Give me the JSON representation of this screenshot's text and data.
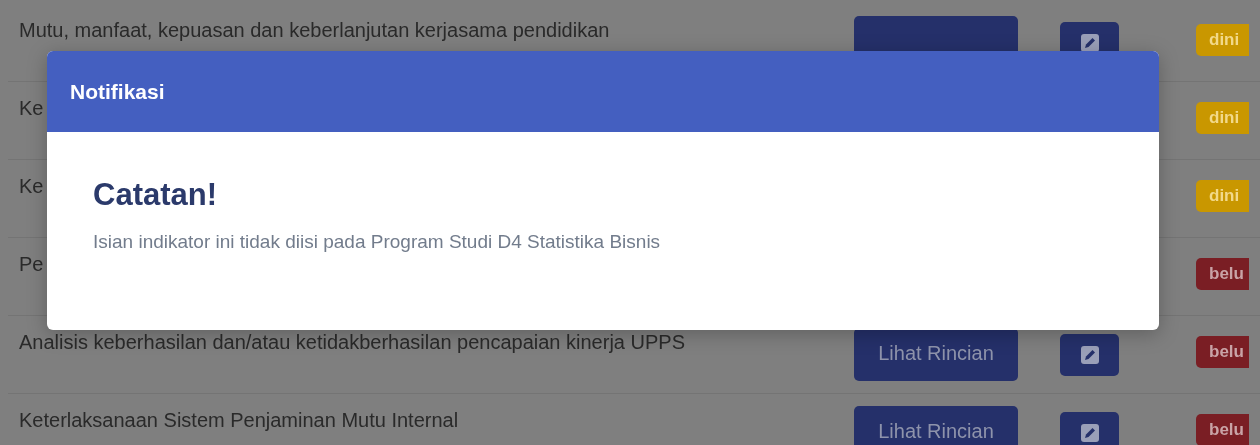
{
  "rows": [
    {
      "title": "Mutu, manfaat, kepuasan dan keberlanjutan kerjasama pendidikan",
      "detail_button": true,
      "edit": true,
      "status": {
        "label": "dini",
        "kind": "filled"
      }
    },
    {
      "title": "Ke",
      "status": {
        "label": "dini",
        "kind": "filled"
      }
    },
    {
      "title": "Ke",
      "status": {
        "label": "dini",
        "kind": "filled"
      }
    },
    {
      "title": "Pe",
      "status": {
        "label": "belu",
        "kind": "empty"
      }
    },
    {
      "title": "Analisis keberhasilan dan/atau ketidakberhasilan pencapaian kinerja UPPS",
      "detail_button": true,
      "detail_label": "Lihat Rincian",
      "edit": true,
      "status": {
        "label": "belu",
        "kind": "empty"
      }
    },
    {
      "title": "Keterlaksanaan Sistem Penjaminan Mutu Internal",
      "detail_button": true,
      "detail_label": "Lihat Rincian",
      "edit": true,
      "status": {
        "label": "belu",
        "kind": "empty"
      }
    }
  ],
  "modal": {
    "title": "Notifikasi",
    "heading": "Catatan!",
    "message": "Isian indikator ini tidak diisi pada Program Studi D4 Statistika Bisnis"
  }
}
